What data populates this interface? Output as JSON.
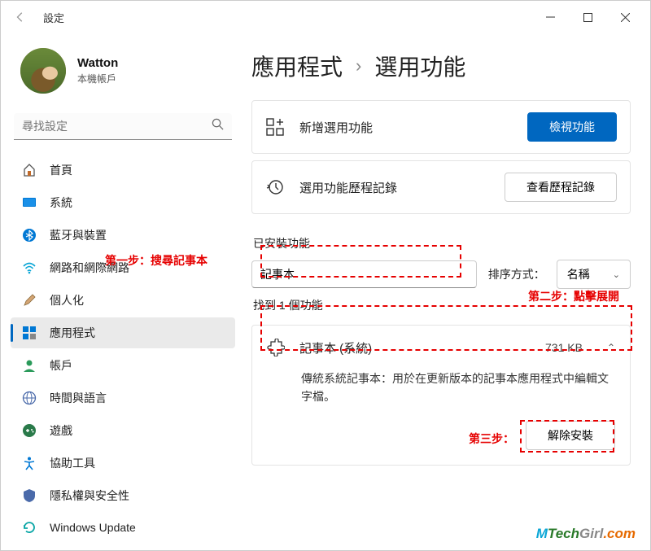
{
  "window": {
    "title": "設定"
  },
  "profile": {
    "name": "Watton",
    "sub": "本機帳戶"
  },
  "search": {
    "placeholder": "尋找設定"
  },
  "nav": {
    "home": "首頁",
    "system": "系統",
    "bluetooth": "藍牙與裝置",
    "network": "網路和網際網路",
    "personalization": "個人化",
    "apps": "應用程式",
    "accounts": "帳戶",
    "time": "時間與語言",
    "gaming": "遊戲",
    "accessibility": "協助工具",
    "privacy": "隱私權與安全性",
    "update": "Windows Update"
  },
  "breadcrumb": {
    "parent": "應用程式",
    "current": "選用功能"
  },
  "cards": {
    "add": {
      "label": "新增選用功能",
      "button": "檢視功能"
    },
    "history": {
      "label": "選用功能歷程記錄",
      "button": "查看歷程記錄"
    }
  },
  "installed": {
    "title": "已安裝功能",
    "filter_value": "記事本",
    "sort_label": "排序方式：",
    "sort_value": "名稱",
    "count": "找到 1 個功能"
  },
  "result": {
    "name": "記事本 (系統)",
    "size": "731 KB",
    "desc": "傳統系統記事本：用於在更新版本的記事本應用程式中編輯文字檔。",
    "uninstall": "解除安裝"
  },
  "annotations": {
    "step1": "第一步：搜尋記事本",
    "step2": "第二步：點擊展開",
    "step3": "第三步："
  },
  "watermark": {
    "brand_m": "M",
    "brand_tech": "Tech",
    "brand_girl": "Girl",
    "brand_com": ".com"
  }
}
